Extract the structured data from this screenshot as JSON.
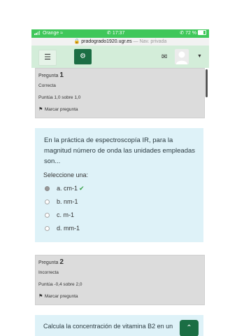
{
  "status_bar": {
    "carrier": "Orange",
    "time": "17:37",
    "battery": "72 %",
    "battery_level": 0.72
  },
  "url_bar": {
    "domain": "pradogrado1920.ugr.es",
    "mode": "— Nav. privada"
  },
  "navbar": {
    "icons": [
      "menu-icon",
      "cogs-icon",
      "envelope-icon",
      "avatar",
      "caret-down-icon"
    ]
  },
  "questions": [
    {
      "label": "Pregunta",
      "number": "1",
      "status": "Correcta",
      "score": "Puntúa 1,0 sobre 1,0",
      "flag_label": "Marcar pregunta",
      "text": "En la práctica de espectroscopía IR, para la magnitud número de onda las unidades empleadas son...",
      "prompt": "Seleccione una:",
      "options": [
        {
          "label": "a. cm-1",
          "selected": true,
          "correct": true
        },
        {
          "label": "b. nm-1",
          "selected": false,
          "correct": false
        },
        {
          "label": "c. m-1",
          "selected": false,
          "correct": false
        },
        {
          "label": "d. mm-1",
          "selected": false,
          "correct": false
        }
      ]
    },
    {
      "label": "Pregunta",
      "number": "2",
      "status": "Incorrecta",
      "score": "Puntúa -0,4 sobre 2,0",
      "flag_label": "Marcar pregunta",
      "text": "Calcula la concentración de vitamina B2 en un"
    }
  ],
  "back_to_top_icon": "chevron-up-icon"
}
